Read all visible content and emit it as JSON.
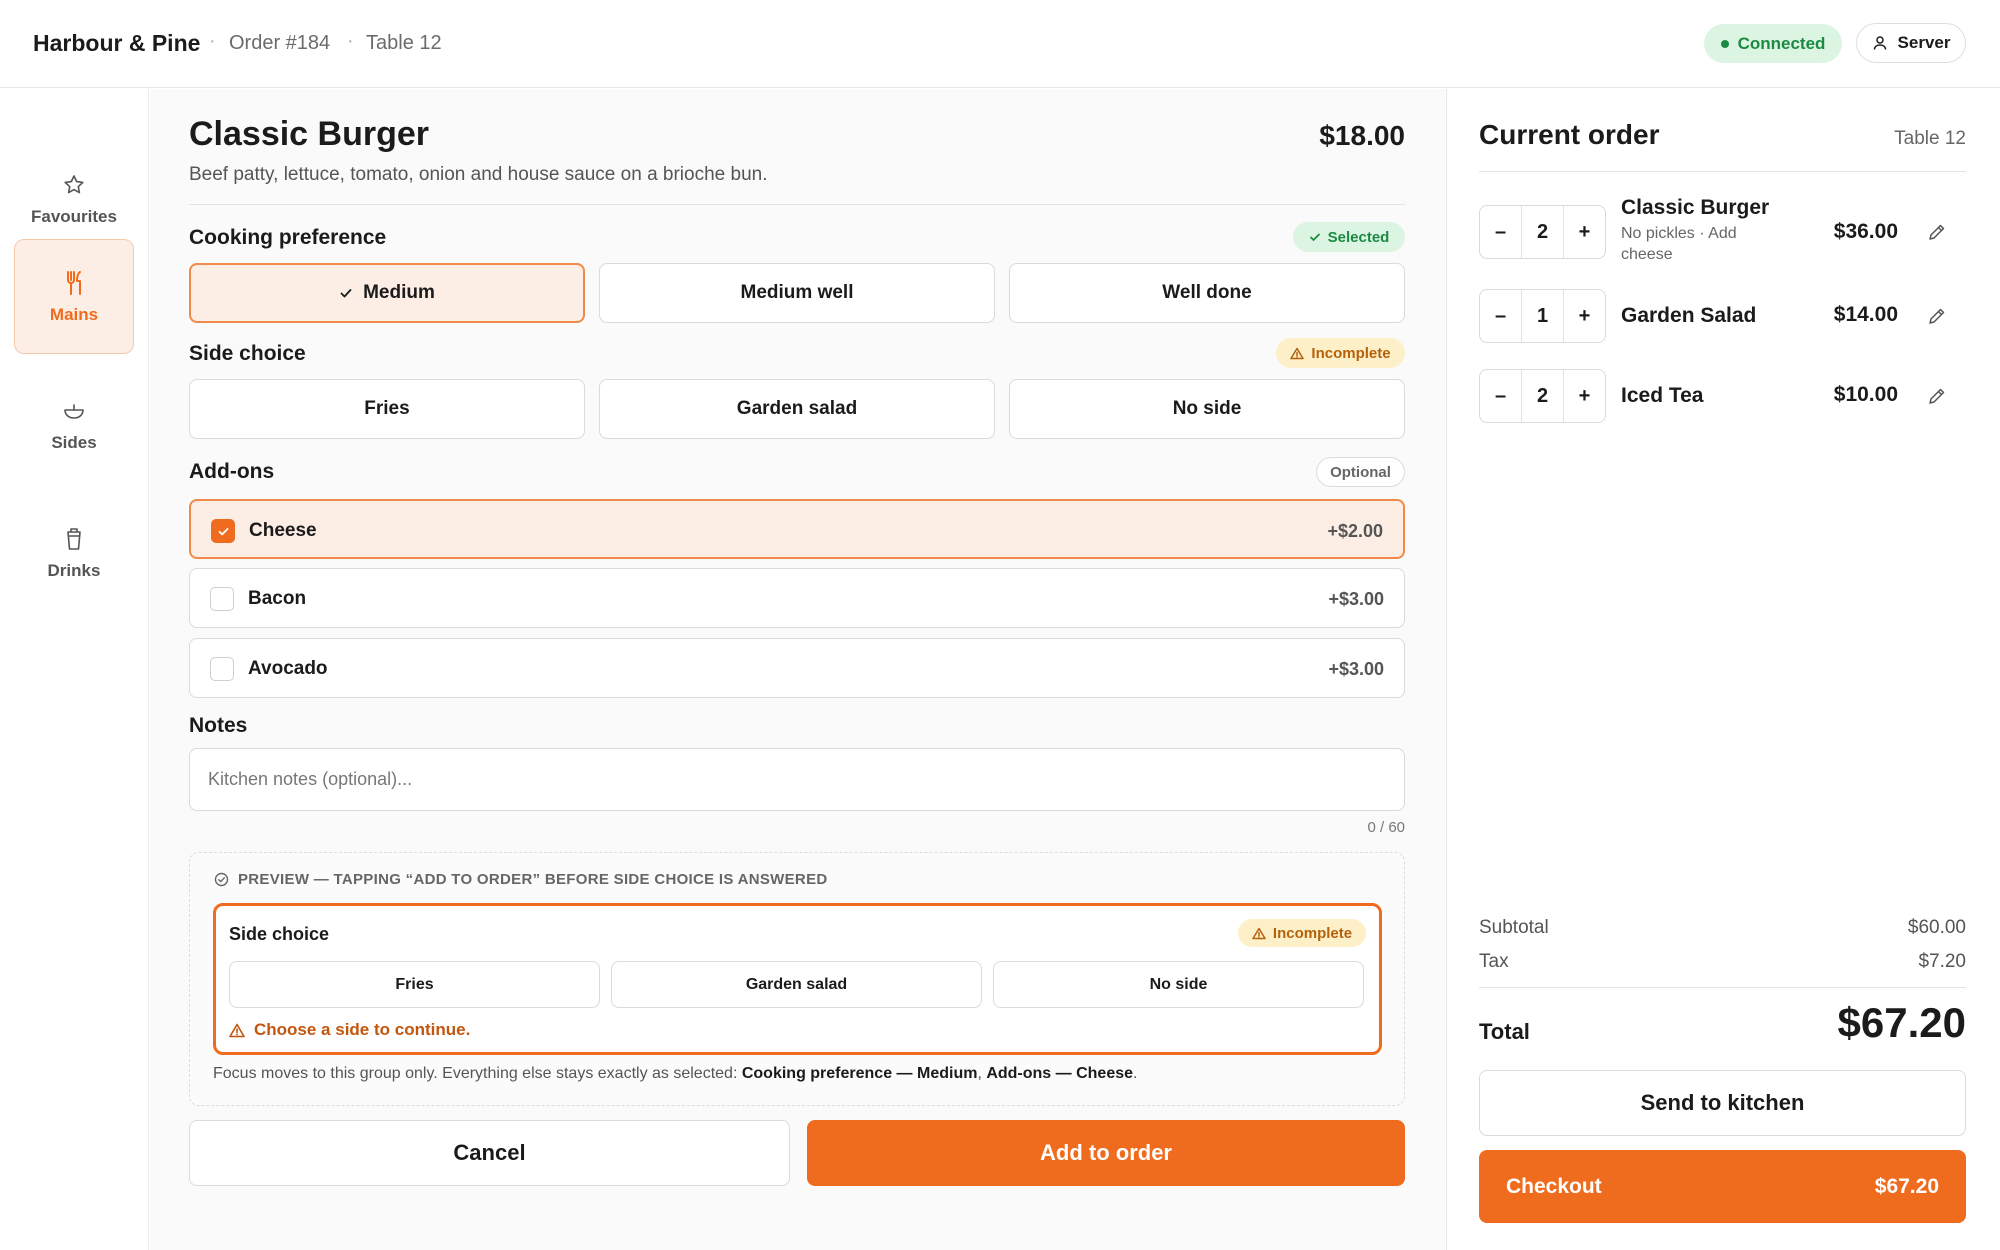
{
  "header": {
    "brand": "Harbour & Pine",
    "order": "Order #184",
    "table": "Table 12",
    "status": "Connected",
    "user_button": "Server"
  },
  "nav": {
    "items": [
      {
        "label": "Favourites",
        "icon": "star-icon"
      },
      {
        "label": "Mains",
        "icon": "utensils-icon",
        "active": true
      },
      {
        "label": "Sides",
        "icon": "bowl-icon"
      },
      {
        "label": "Drinks",
        "icon": "cup-icon"
      }
    ]
  },
  "item": {
    "title": "Classic Burger",
    "price": "$18.00",
    "description": "Beef patty, lettuce, tomato, onion and house sauce on a brioche bun."
  },
  "cooking": {
    "label": "Cooking preference",
    "badge": "Selected",
    "options": [
      "Medium",
      "Medium well",
      "Well done"
    ],
    "selected": "Medium"
  },
  "side": {
    "label": "Side choice",
    "badge": "Incomplete",
    "options": [
      "Fries",
      "Garden salad",
      "No side"
    ]
  },
  "addons": {
    "label": "Add-ons",
    "badge": "Optional",
    "items": [
      {
        "name": "Cheese",
        "price": "+$2.00",
        "checked": true
      },
      {
        "name": "Bacon",
        "price": "+$3.00",
        "checked": false
      },
      {
        "name": "Avocado",
        "price": "+$3.00",
        "checked": false
      }
    ]
  },
  "notes": {
    "label": "Notes",
    "placeholder": "Kitchen notes (optional)...",
    "counter": "0 / 60"
  },
  "preview": {
    "heading": "PREVIEW — TAPPING “ADD TO ORDER” BEFORE SIDE CHOICE IS ANSWERED",
    "label": "Side choice",
    "badge": "Incomplete",
    "options": [
      "Fries",
      "Garden salad",
      "No side"
    ],
    "error": "Choose a side to continue.",
    "footer_prefix": "Focus moves to this group only. Everything else stays exactly as selected: ",
    "footer_cooking": "Cooking preference — Medium",
    "footer_sep": ", ",
    "footer_addons": "Add-ons — Cheese",
    "footer_end": "."
  },
  "actions": {
    "cancel": "Cancel",
    "add": "Add to order"
  },
  "order": {
    "title": "Current order",
    "table": "Table 12",
    "items": [
      {
        "qty": "2",
        "name": "Classic Burger",
        "mods": "No pickles · Add cheese",
        "price": "$36.00"
      },
      {
        "qty": "1",
        "name": "Garden Salad",
        "mods": "",
        "price": "$14.00"
      },
      {
        "qty": "2",
        "name": "Iced Tea",
        "mods": "",
        "price": "$10.00"
      }
    ],
    "minus": "–",
    "plus": "+",
    "subtotal_label": "Subtotal",
    "subtotal": "$60.00",
    "tax_label": "Tax",
    "tax": "$7.20",
    "total_label": "Total",
    "total": "$67.20",
    "send_button": "Send to kitchen",
    "checkout_label": "Checkout",
    "checkout_amount": "$67.20"
  },
  "colors": {
    "accent": "#ef6c1e",
    "accent_soft": "#fdeee5",
    "success": "#1c8a43",
    "warning": "#b5620b"
  }
}
